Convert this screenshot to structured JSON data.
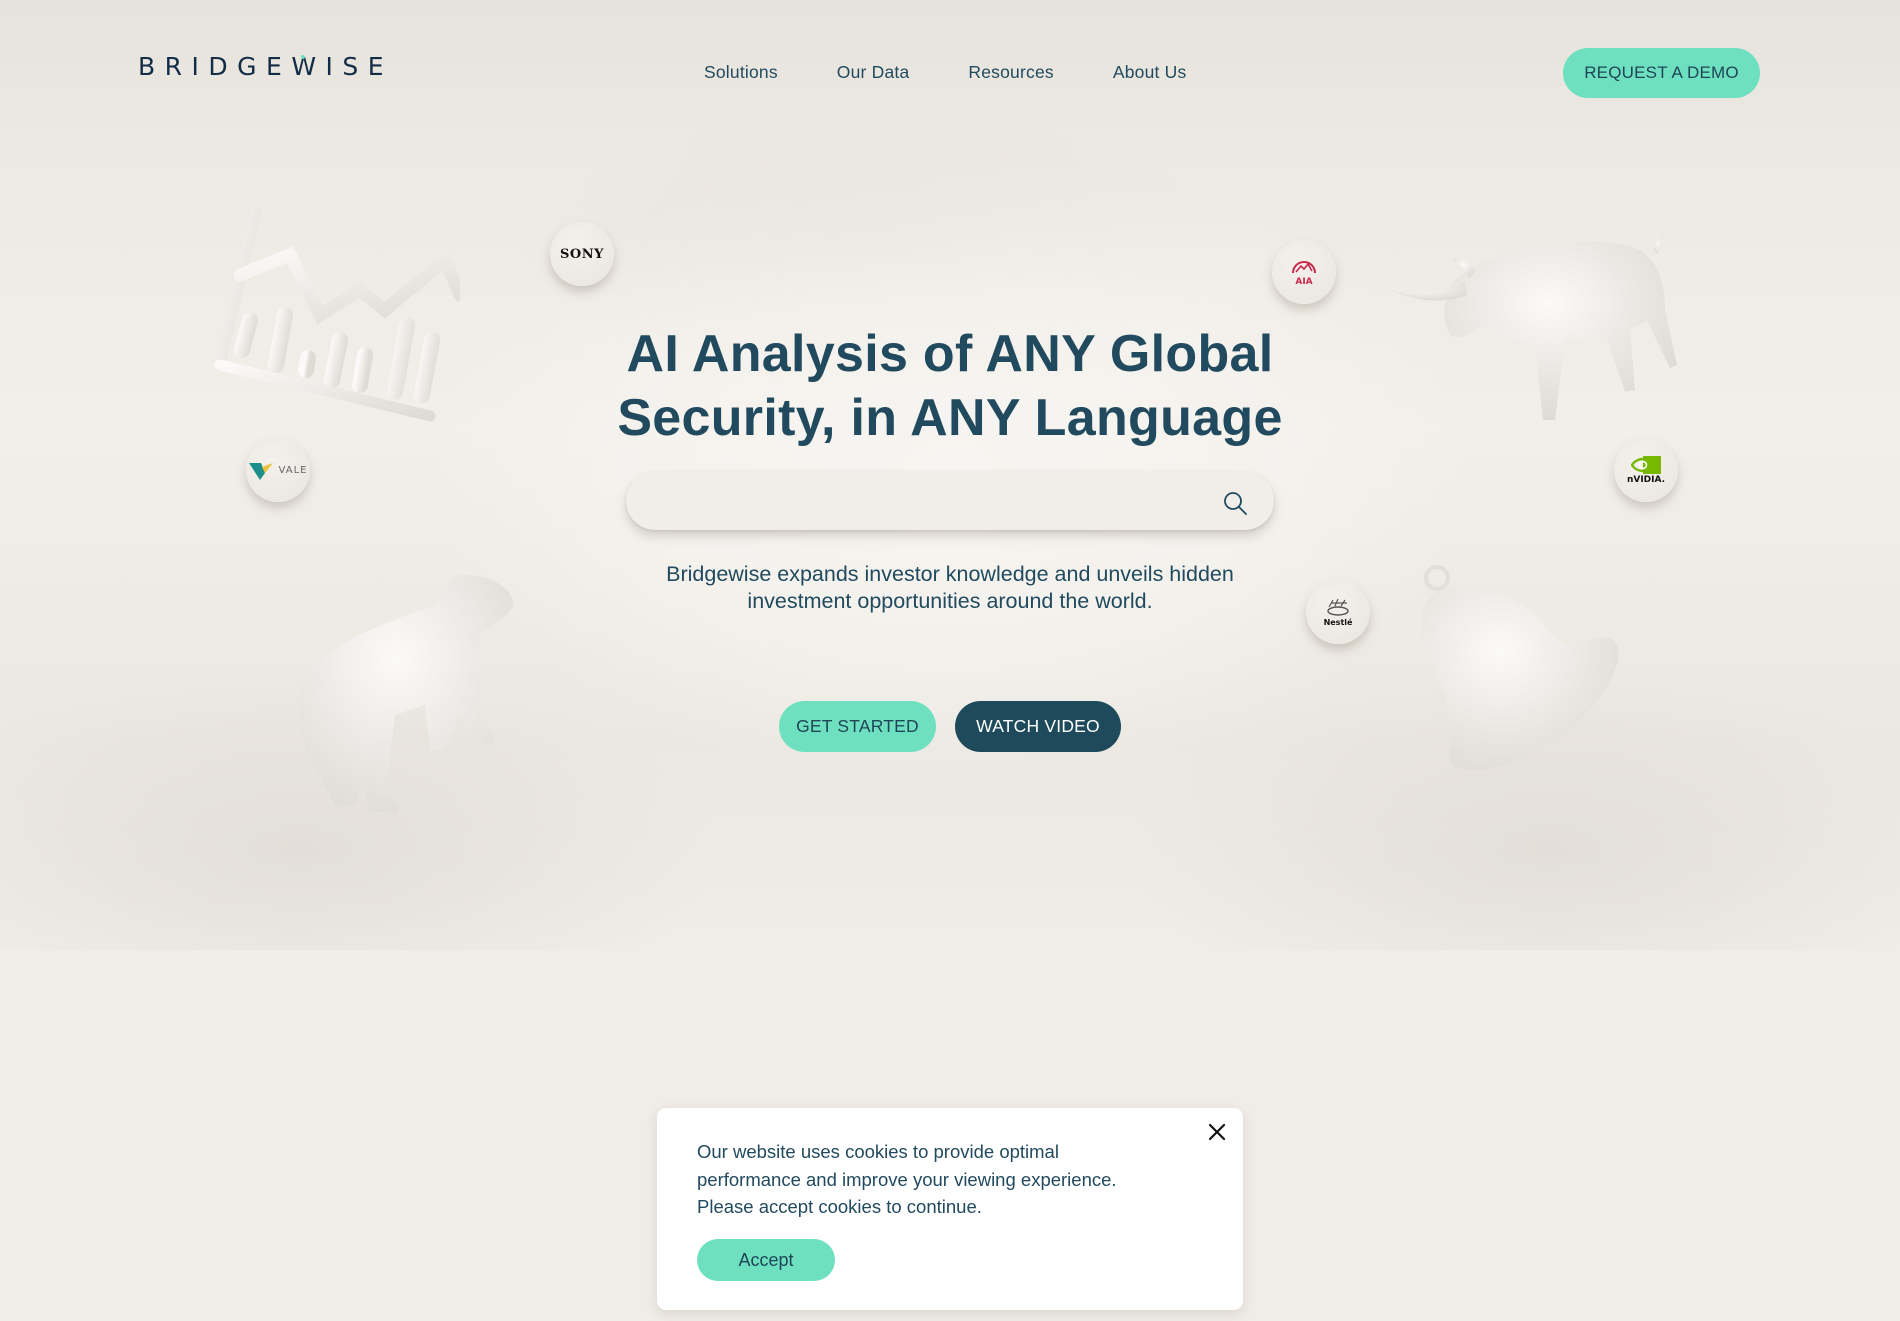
{
  "brand": {
    "name": "BRIDGEWISE",
    "accent_color": "#6ee0c0",
    "primary_color": "#214a5e",
    "dark_button_color": "#1f4a5c"
  },
  "nav": {
    "items": [
      {
        "label": "Solutions"
      },
      {
        "label": "Our Data"
      },
      {
        "label": "Resources"
      },
      {
        "label": "About Us"
      }
    ],
    "cta_label": "REQUEST A DEMO"
  },
  "hero": {
    "headline_line1": "AI Analysis of ANY Global",
    "headline_line2": "Security, in ANY Language",
    "search": {
      "value": "",
      "placeholder": "",
      "icon": "search-icon"
    },
    "subtitle_line1": "Bridgewise expands investor knowledge and unveils hidden",
    "subtitle_line2": "investment opportunities around the world.",
    "primary_cta": "GET STARTED",
    "secondary_cta": "WATCH VIDEO"
  },
  "company_logos": [
    {
      "name": "SONY",
      "label": "SONY"
    },
    {
      "name": "VALE",
      "label": "VALE"
    },
    {
      "name": "AIA",
      "label": "AIA"
    },
    {
      "name": "NVIDIA",
      "label": "nVIDIA."
    },
    {
      "name": "Nestle",
      "label": "Nestlé"
    }
  ],
  "decorations": [
    "chart-figure",
    "bull-figure",
    "bear-figure",
    "bell-figure"
  ],
  "cookie_banner": {
    "line1": "Our website uses cookies to provide optimal",
    "line2": "performance and improve your viewing experience.",
    "line3": "Please accept cookies to continue.",
    "accept_label": "Accept",
    "close_icon": "close-icon"
  }
}
